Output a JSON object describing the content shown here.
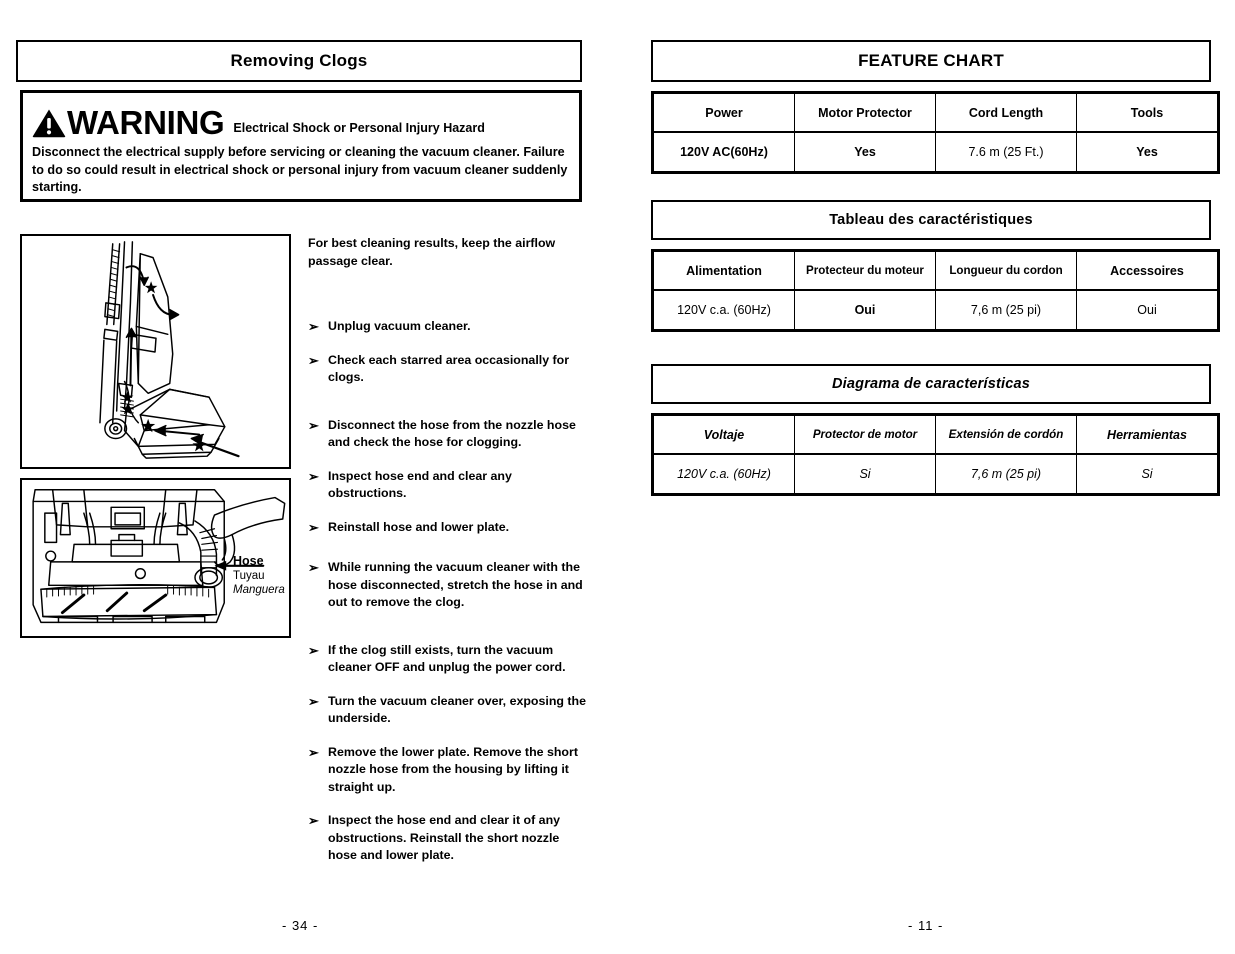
{
  "left_page": {
    "section_title": "Removing Clogs",
    "warning": {
      "icon": "warning-triangle-icon",
      "word": "WARNING",
      "subtitle": "Electrical Shock or Personal Injury Hazard",
      "body": "Disconnect the electrical supply before servicing or cleaning the vacuum cleaner. Failure to do so could result in electrical shock or personal injury from vacuum cleaner suddenly starting."
    },
    "illustrations": [
      {
        "name": "upright-vacuum-airflow-diagram"
      },
      {
        "name": "vacuum-underside-hose-diagram"
      }
    ],
    "hose_callout": {
      "english": "Hose",
      "french": "Tuyau",
      "spanish": "Manguera"
    },
    "intro": "For best cleaning results, keep the airflow passage clear.",
    "bullet_glyph": "➢",
    "steps": [
      "Unplug vacuum cleaner.",
      "Check each starred area occasionally for clogs.",
      "Disconnect the hose from the nozzle hose and check the hose for clogging.",
      "Inspect hose end and clear any obstructions.",
      "Reinstall hose and lower plate.",
      "While running the vacuum cleaner with the hose disconnected, stretch the hose in and out to remove the clog.",
      "If the clog still exists, turn the vacuum cleaner OFF and unplug the power cord.",
      "Turn the vacuum cleaner over, exposing the underside.",
      "Remove the lower plate.  Remove the short nozzle hose from the housing by lifting it straight up.",
      "Inspect the hose end and clear it of any obstructions.  Reinstall the short nozzle hose and lower plate."
    ],
    "page_number": "- 34 -"
  },
  "right_page": {
    "english_chart": {
      "title": "FEATURE CHART",
      "headers": [
        "Power",
        "Motor Protector",
        "Cord Length",
        "Tools"
      ],
      "values": [
        "120V AC(60Hz)",
        "Yes",
        "7.6 m (25 Ft.)",
        "Yes"
      ]
    },
    "french_chart": {
      "title": "Tableau des caractéristiques",
      "headers": [
        "Alimentation",
        "Protecteur du moteur",
        "Longueur du cordon",
        "Accessoires"
      ],
      "values": [
        "120V c.a. (60Hz)",
        "Oui",
        "7,6 m (25 pi)",
        "Oui"
      ]
    },
    "spanish_chart": {
      "title": "Diagrama de características",
      "headers": [
        "Voltaje",
        "Protector de motor",
        "Extensión de cordón",
        "Herramientas"
      ],
      "values": [
        "120V c.a. (60Hz)",
        "Si",
        "7,6 m (25 pi)",
        "Si"
      ]
    },
    "page_number": "- 11 -"
  },
  "colors": {
    "ink": "#000000",
    "paper": "#ffffff"
  }
}
